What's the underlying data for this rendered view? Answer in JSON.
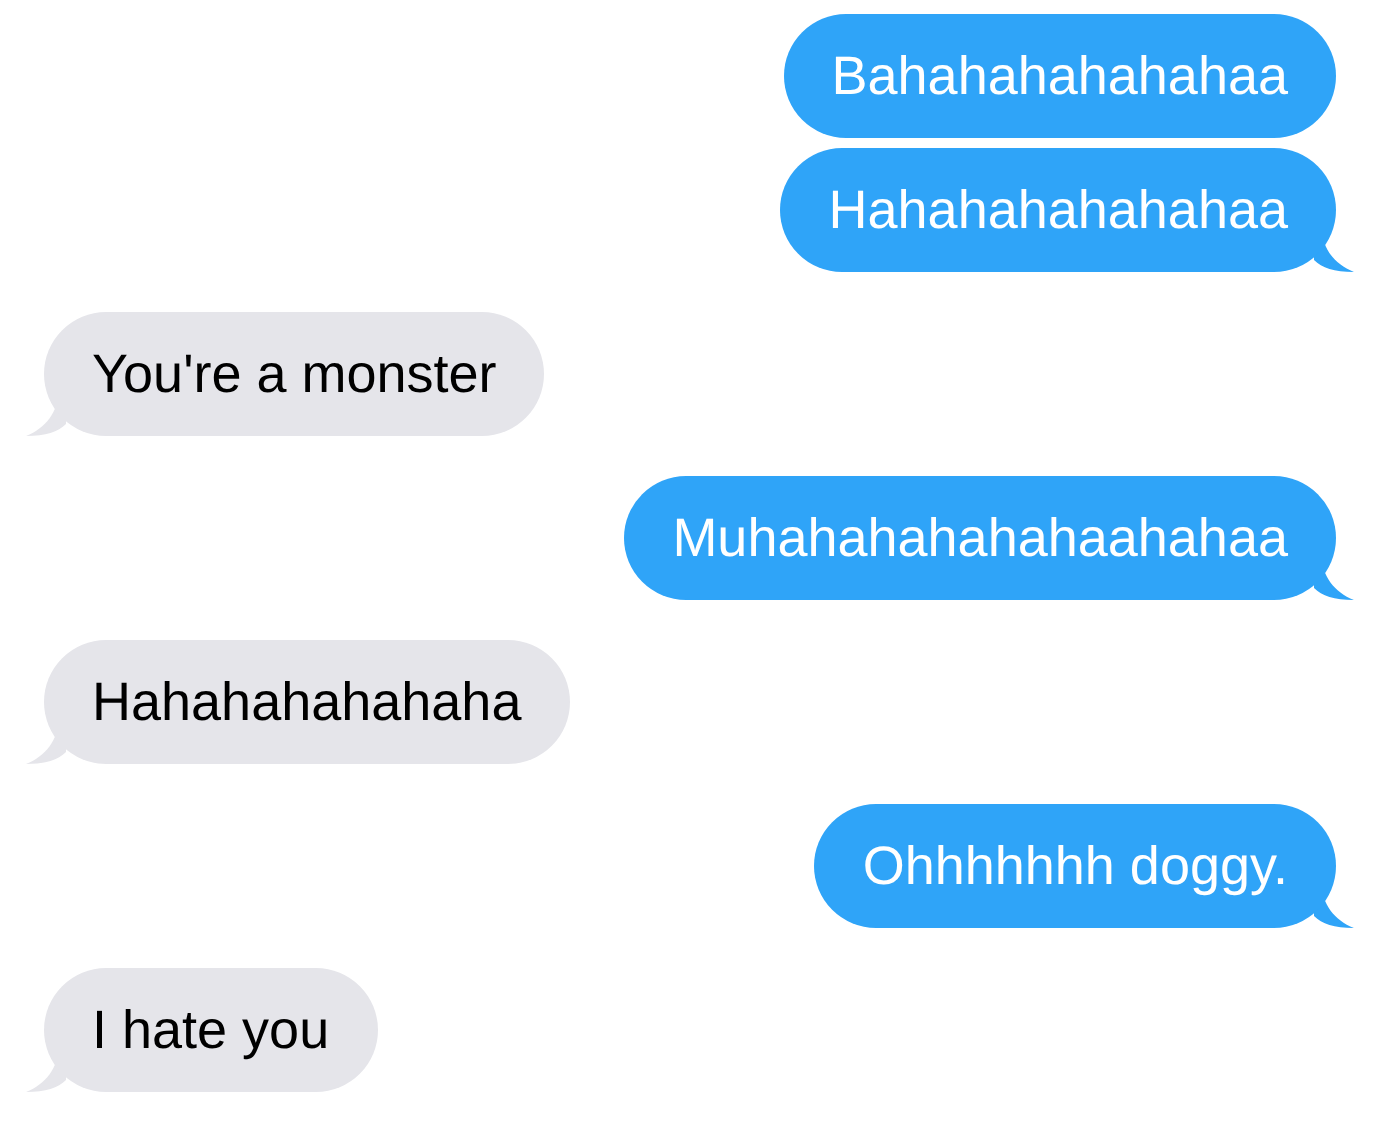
{
  "messages": [
    {
      "kind": "sent",
      "text": "Bahahahahahahaa",
      "tail": false
    },
    {
      "kind": "sent",
      "text": "Hahahahahahahaa",
      "tail": true
    },
    {
      "kind": "received",
      "text": "You're a monster",
      "tail": true
    },
    {
      "kind": "sent",
      "text": "Muhahahahahahaahahaa",
      "tail": true
    },
    {
      "kind": "received",
      "text": "Hahahahahahaha",
      "tail": true
    },
    {
      "kind": "sent",
      "text": "Ohhhhhhh doggy.",
      "tail": true
    },
    {
      "kind": "received",
      "text": "I hate you",
      "tail": true
    }
  ]
}
